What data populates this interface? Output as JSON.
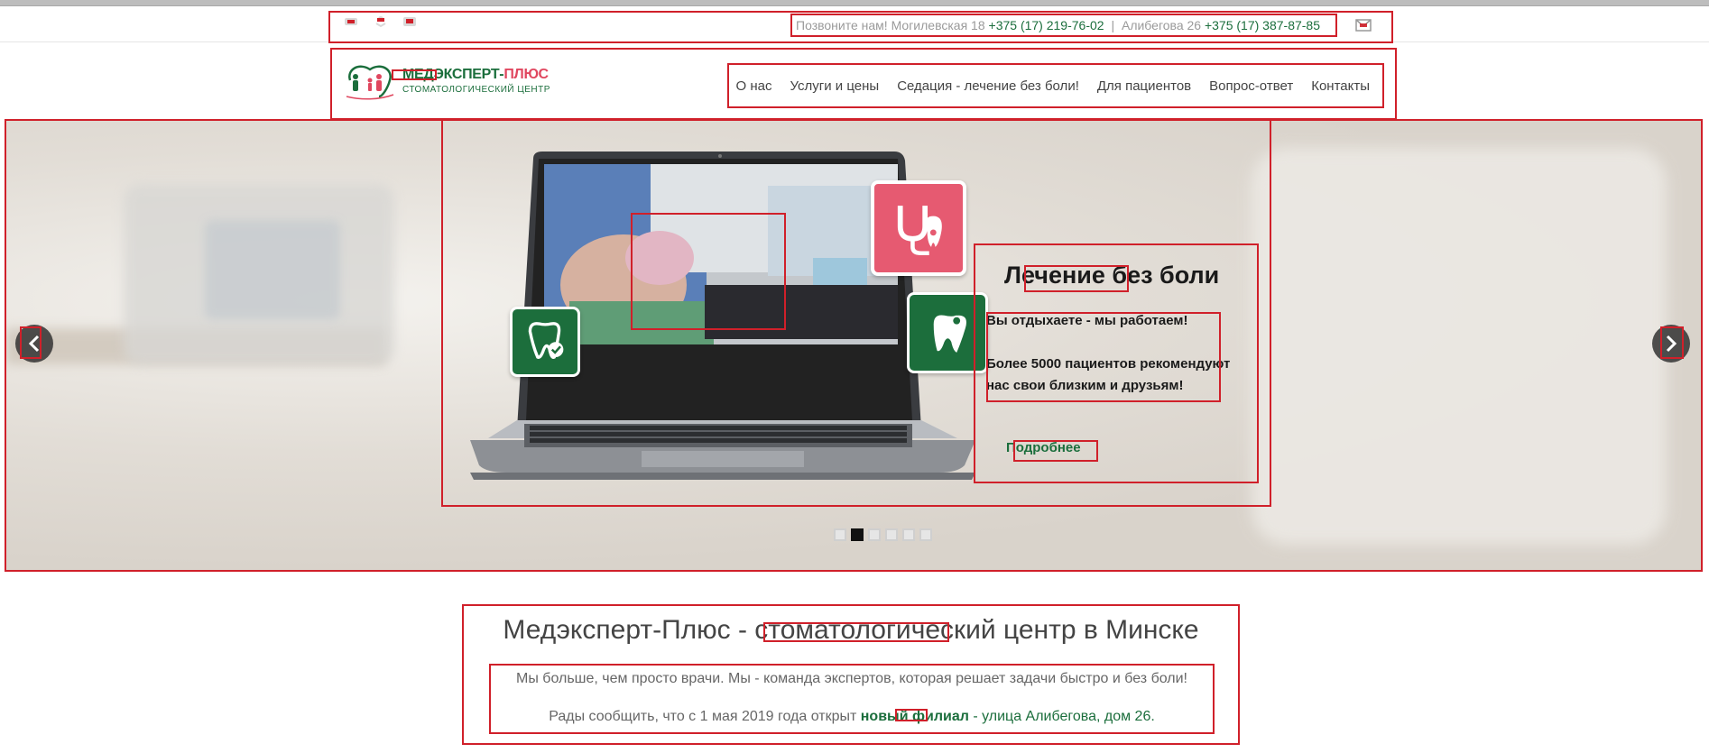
{
  "topbar": {
    "social": [
      {
        "name": "vk-icon"
      },
      {
        "name": "ok-icon"
      },
      {
        "name": "youtube-icon"
      }
    ],
    "call_text": "Позвоните нам!",
    "address1": "Могилевская 18",
    "phone1": "+375 (17) 219-76-02",
    "separator": "|",
    "address2": "Алибегова 26",
    "phone2": "+375 (17) 387-87-85",
    "mail_icon": "mail-icon"
  },
  "header": {
    "logo_title": "МЕДЭКСПЕРТ-",
    "logo_title_plus": "ПЛЮС",
    "logo_subtitle": "СТОМАТОЛОГИЧЕСКИЙ ЦЕНТР",
    "nav": [
      {
        "label": "О нас"
      },
      {
        "label": "Услуги и цены"
      },
      {
        "label": "Седация - лечение без боли!"
      },
      {
        "label": "Для пациентов"
      },
      {
        "label": "Вопрос-ответ"
      },
      {
        "label": "Контакты"
      }
    ]
  },
  "slider": {
    "title": "Лечение без боли",
    "line1": "Вы отдыхаете - мы работаем!",
    "line2": "Более 5000 пациентов рекомендуют нас свои близким и друзьям!",
    "more": "Подробнее",
    "dots": 6,
    "active_dot": 1,
    "colors": {
      "brand_green": "#1b6e3c",
      "brand_pink": "#e65a71"
    }
  },
  "intro": {
    "title": "Медэксперт-Плюс - стоматологический центр в Минске",
    "text1": "Мы больше, чем просто врачи. Мы - команда экспертов, которая решает задачи быстро и без боли!",
    "text2_prefix": "Рады сообщить, что с 1 мая 2019 года открыт ",
    "text2_strong": "новый филиал",
    "text2_suffix": " - улица Алибегова, дом 26."
  }
}
